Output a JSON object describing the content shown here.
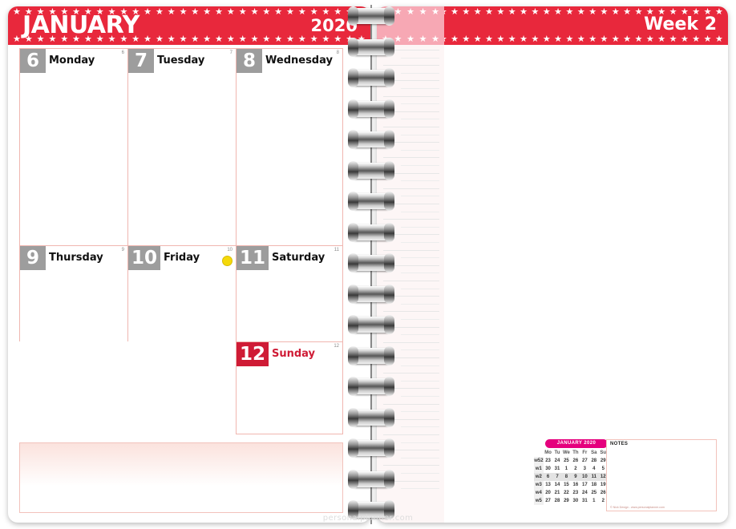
{
  "header_left": {
    "month": "JANUARY",
    "year": "2020",
    "star_glyph": "★"
  },
  "header_right": {
    "week_label": "Week 2",
    "star_glyph": "★"
  },
  "days": [
    {
      "num": "6",
      "name": "Monday",
      "doy": "6",
      "weekend": false,
      "moon": false
    },
    {
      "num": "7",
      "name": "Tuesday",
      "doy": "7",
      "weekend": false,
      "moon": false
    },
    {
      "num": "8",
      "name": "Wednesday",
      "doy": "8",
      "weekend": false,
      "moon": false
    },
    {
      "num": "9",
      "name": "Thursday",
      "doy": "9",
      "weekend": false,
      "moon": false
    },
    {
      "num": "10",
      "name": "Friday",
      "doy": "10",
      "weekend": false,
      "moon": true
    },
    {
      "num": "11",
      "name": "Saturday",
      "doy": "11",
      "weekend": false,
      "moon": false
    },
    {
      "num": "12",
      "name": "Sunday",
      "doy": "12",
      "weekend": true,
      "moon": false
    }
  ],
  "mini_calendar": {
    "title": "JANUARY 2020",
    "weekday_headers": [
      "Mo",
      "Tu",
      "We",
      "Th",
      "Fr",
      "Sa",
      "Su"
    ],
    "week_label_header": "",
    "rows": [
      {
        "week": "w52",
        "days": [
          "23",
          "24",
          "25",
          "26",
          "27",
          "28",
          "29"
        ],
        "styles": [
          "dim",
          "dim",
          "dim",
          "dim",
          "dim",
          "dim",
          "dim"
        ],
        "highlight": false
      },
      {
        "week": "w1",
        "days": [
          "30",
          "31",
          "1",
          "2",
          "3",
          "4",
          "5"
        ],
        "styles": [
          "dim",
          "dim",
          "red",
          "normal",
          "normal",
          "normal",
          "red"
        ],
        "highlight": false
      },
      {
        "week": "w2",
        "days": [
          "6",
          "7",
          "8",
          "9",
          "10",
          "11",
          "12"
        ],
        "styles": [
          "normal",
          "normal",
          "normal",
          "normal",
          "normal",
          "normal",
          "red"
        ],
        "highlight": true
      },
      {
        "week": "w3",
        "days": [
          "13",
          "14",
          "15",
          "16",
          "17",
          "18",
          "19"
        ],
        "styles": [
          "normal",
          "normal",
          "normal",
          "normal",
          "normal",
          "normal",
          "red"
        ],
        "highlight": false
      },
      {
        "week": "w4",
        "days": [
          "20",
          "21",
          "22",
          "23",
          "24",
          "25",
          "26"
        ],
        "styles": [
          "red",
          "normal",
          "normal",
          "normal",
          "normal",
          "normal",
          "red"
        ],
        "highlight": false
      },
      {
        "week": "w5",
        "days": [
          "27",
          "28",
          "29",
          "30",
          "31",
          "1",
          "2"
        ],
        "styles": [
          "normal",
          "normal",
          "normal",
          "normal",
          "normal",
          "dim",
          "dim"
        ],
        "highlight": false
      }
    ]
  },
  "notes_box": {
    "label": "NOTES",
    "credit": "© Nick Design - www.personalplanner.com"
  },
  "watermark": "personalplanner.com",
  "colors": {
    "brand_red": "#e8283c",
    "sunday_red": "#cf1b35",
    "day_box_gray": "#9d9d9d",
    "rule_pink": "#f0b6b0",
    "minical_magenta": "#e5007d",
    "moon_yellow": "#f5d90a"
  }
}
